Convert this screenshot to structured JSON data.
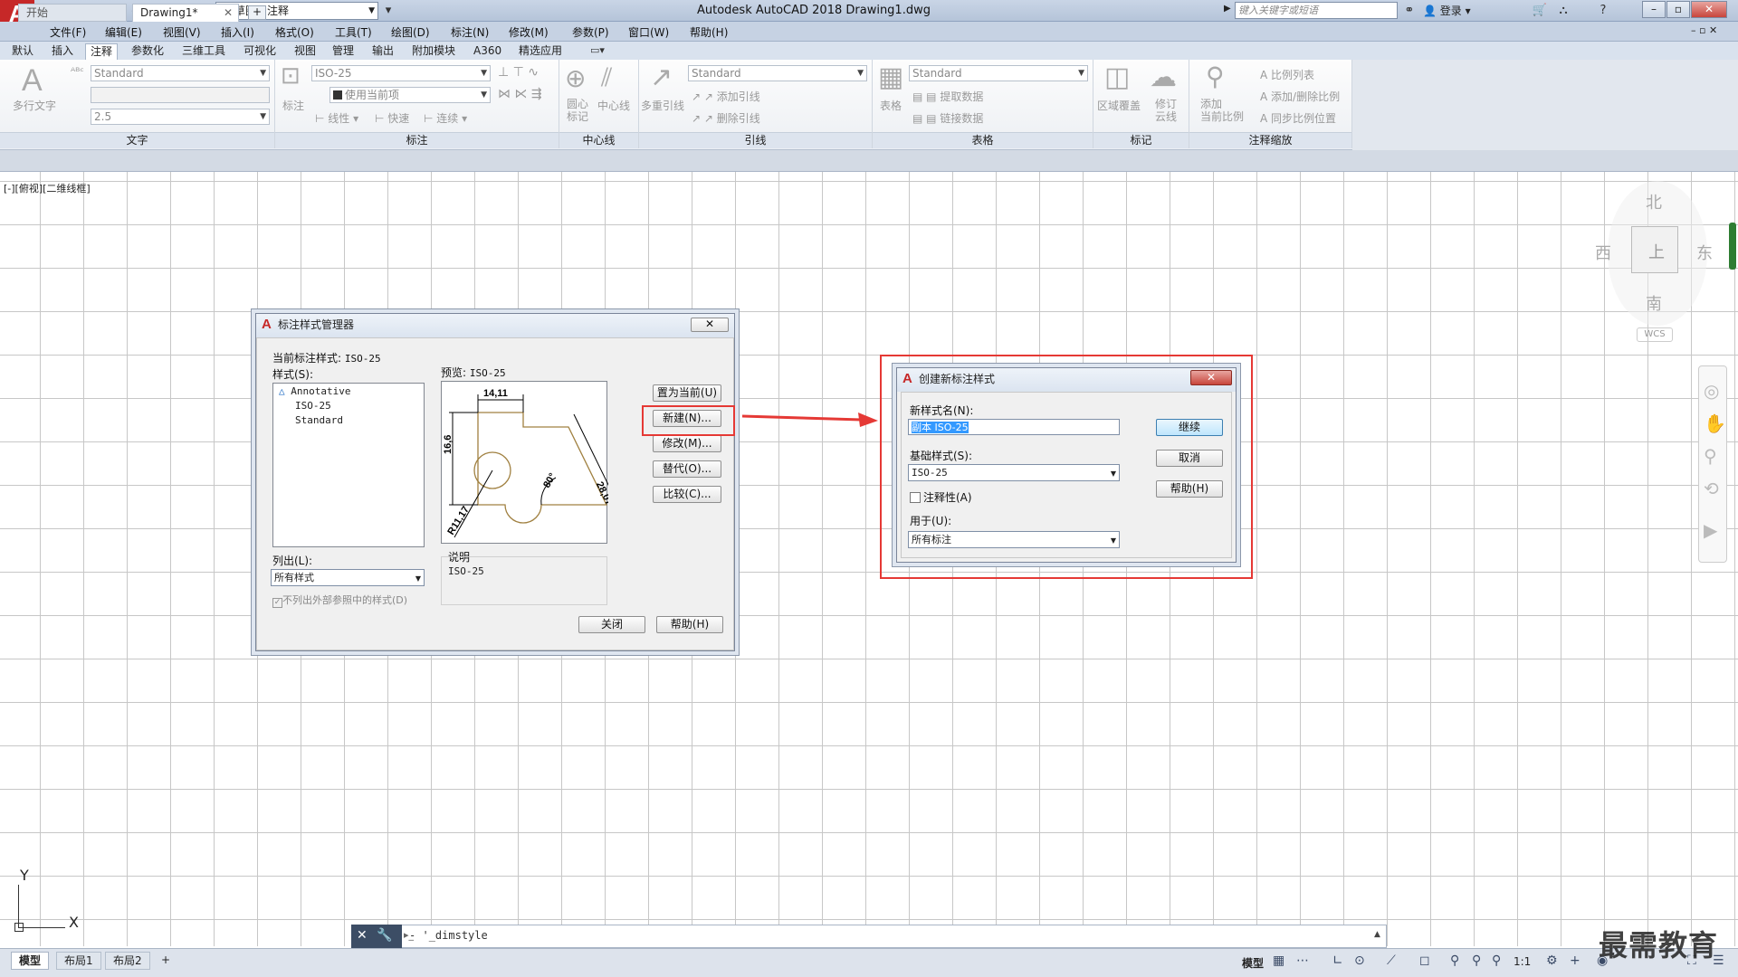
{
  "titlebar": {
    "logo": "A",
    "workspace": "草图与注释",
    "app_title": "Autodesk AutoCAD 2018    Drawing1.dwg",
    "search_placeholder": "键入关键字或短语",
    "login": "登录"
  },
  "menu": [
    "文件(F)",
    "编辑(E)",
    "视图(V)",
    "插入(I)",
    "格式(O)",
    "工具(T)",
    "绘图(D)",
    "标注(N)",
    "修改(M)",
    "参数(P)",
    "窗口(W)",
    "帮助(H)"
  ],
  "ribbon_tabs": [
    "默认",
    "插入",
    "注释",
    "参数化",
    "三维工具",
    "可视化",
    "视图",
    "管理",
    "输出",
    "附加模块",
    "A360",
    "精选应用"
  ],
  "ribbon": {
    "text_group": {
      "label": "文字",
      "big_button": "多行文字",
      "style": "Standard",
      "height": "2.5"
    },
    "dim_group": {
      "label": "标注",
      "big_button": "标注",
      "style": "ISO-25",
      "layer": "使用当前项",
      "linear": "线性",
      "quick": "快速",
      "continue": "连续"
    },
    "center_group": {
      "label": "中心线",
      "center_mark": "圆心\n标记",
      "centerline": "中心线"
    },
    "leader_group": {
      "label": "引线",
      "big_button": "多重引线",
      "style": "Standard",
      "add": "添加引线",
      "remove": "删除引线"
    },
    "table_group": {
      "label": "表格",
      "big_button": "表格",
      "style": "Standard",
      "extract": "提取数据",
      "link": "链接数据"
    },
    "mark_group": {
      "label": "标记",
      "wipeout": "区域覆盖",
      "revcloud": "修订\n云线"
    },
    "scale_group": {
      "label": "注释缩放",
      "add_scale": "添加\n当前比例",
      "scale_list": "比例列表",
      "add_delete": "添加/删除比例",
      "sync": "同步比例位置"
    }
  },
  "doc_tabs": {
    "start": "开始",
    "drawing": "Drawing1*",
    "add": "+"
  },
  "viewport_label": "[-][俯视][二维线框]",
  "viewcube": {
    "north": "北",
    "south": "南",
    "east": "东",
    "west": "西",
    "face": "上",
    "wcs": "WCS"
  },
  "ucs": {
    "x": "X",
    "y": "Y"
  },
  "command_line": {
    "text": "'_dimstyle",
    "prompt": "-"
  },
  "layout_tabs": [
    "模型",
    "布局1",
    "布局2",
    "+"
  ],
  "status": {
    "model": "模型",
    "scale": "1:1"
  },
  "watermark": "最需教育",
  "dim_manager": {
    "title": "标注样式管理器",
    "current_style_label": "当前标注样式:",
    "current_style": "ISO-25",
    "styles_label": "样式(S):",
    "styles": [
      "Annotative",
      "ISO-25",
      "Standard"
    ],
    "preview_label": "预览:",
    "preview_style": "ISO-25",
    "list_label": "列出(L):",
    "list_value": "所有样式",
    "no_xref_label": "不列出外部参照中的样式(D)",
    "description_label": "说明",
    "description": "ISO-25",
    "buttons": {
      "set_current": "置为当前(U)",
      "new": "新建(N)...",
      "modify": "修改(M)...",
      "override": "替代(O)...",
      "compare": "比较(C)..."
    },
    "close": "关闭",
    "help": "帮助(H)",
    "preview_dims": {
      "top": "14,11",
      "left": "16,6",
      "right": "28,07",
      "angle": "80°",
      "radius": "R11,17"
    }
  },
  "new_style_dialog": {
    "title": "创建新标注样式",
    "name_label": "新样式名(N):",
    "name_value": "副本 ISO-25",
    "base_label": "基础样式(S):",
    "base_value": "ISO-25",
    "annotative_label": "注释性(A)",
    "use_for_label": "用于(U):",
    "use_for_value": "所有标注",
    "continue": "继续",
    "cancel": "取消",
    "help": "帮助(H)"
  },
  "colors": {
    "highlight": "#e53935",
    "logo": "#c62828",
    "ribbon_bg": "#eceff3"
  }
}
